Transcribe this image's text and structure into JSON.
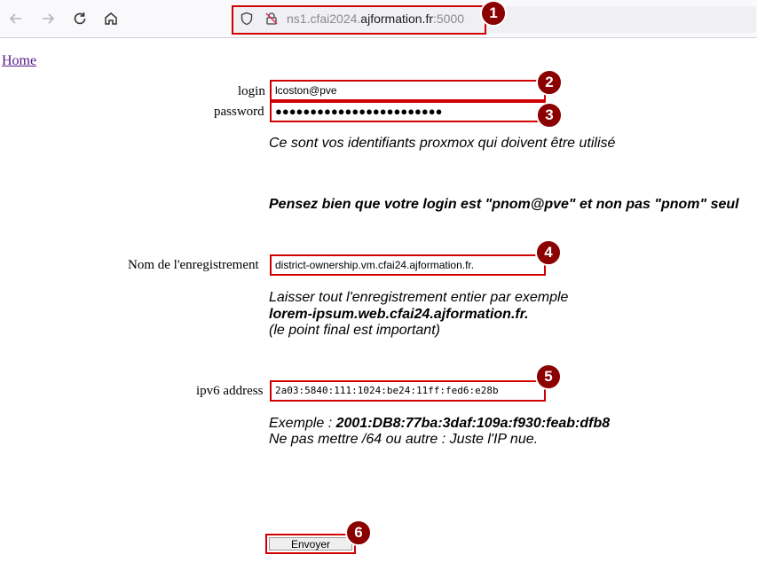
{
  "browser": {
    "url_prefix": "ns1.cfai2024.",
    "url_host": "ajformation.fr",
    "url_port": ":5000",
    "icons": [
      "back-arrow-icon",
      "forward-arrow-icon",
      "reload-icon",
      "home-icon",
      "shield-icon",
      "insecure-lock-icon"
    ]
  },
  "page": {
    "home_link": "Home"
  },
  "form": {
    "login_label": "login",
    "login_value": "lcoston@pve",
    "password_label": "password",
    "password_value": "●●●●●●●●●●●●●●●●●●●●●●●●",
    "note_credentials": "Ce sont vos identifiants proxmox qui doivent être utilisé",
    "note_login_format": "Pensez bien que votre login est \"pnom@pve\" et non pas \"pnom\" seul",
    "record_label": "Nom de l'enregistrement",
    "record_value": "district-ownership.vm.cfai24.ajformation.fr.",
    "record_note_1": "Laisser tout l'enregistrement entier par exemple",
    "record_note_2": "lorem-ipsum.web.cfai24.ajformation.fr.",
    "record_note_3": "(le point final est important)",
    "ipv6_label": "ipv6 address",
    "ipv6_value": "2a03:5840:111:1024:be24:11ff:fed6:e28b",
    "ipv6_note_prefix": "Exemple : ",
    "ipv6_note_example": "2001:DB8:77ba:3daf:109a:f930:feab:dfb8",
    "ipv6_note_2": "Ne pas mettre /64 ou autre : Juste l'IP nue.",
    "submit_label": "Envoyer"
  },
  "annotations": {
    "badge_1": "1",
    "badge_2": "2",
    "badge_3": "3",
    "badge_4": "4",
    "badge_5": "5",
    "badge_6": "6",
    "highlight_color": "#d00000",
    "badge_color": "#8b0000"
  }
}
